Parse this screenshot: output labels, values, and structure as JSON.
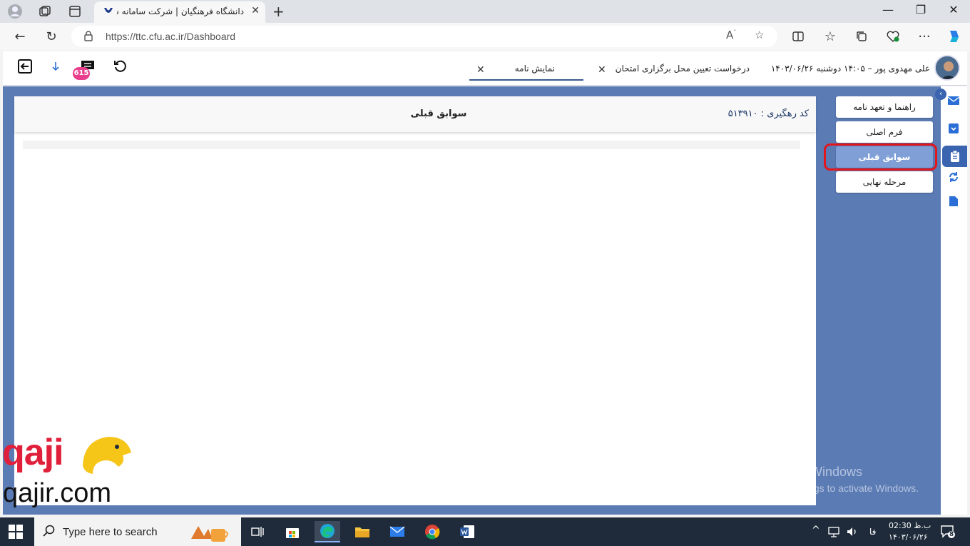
{
  "browser": {
    "tab_title": "دانشگاه فرهنگیان | شرکت سامانه س",
    "url": "https://ttc.cfu.ac.ir/Dashboard"
  },
  "app": {
    "user_line": "علی مهدوی پور – ۱۴:۰۵ دوشنبه ۱۴۰۳/۰۶/۲۶",
    "request_tab": "درخواست تعیین محل برگزاری امتحان",
    "active_tab": "نمایش نامه",
    "notification_count": "615"
  },
  "panel": {
    "title": "سوابق قبلی",
    "tracking": "کد رهگیری : ۵۱۳۹۱۰"
  },
  "steps": [
    {
      "label": "راهنما و تعهد نامه",
      "current": false
    },
    {
      "label": "فرم اصلی",
      "current": false
    },
    {
      "label": "سوابق قبلی",
      "current": true
    },
    {
      "label": "مرحله نهایی",
      "current": false
    }
  ],
  "watermark": {
    "activate_title": "Activate Windows",
    "activate_sub": "Go to Settings to activate Windows.",
    "brand_word": "qaji",
    "brand_domain": "qajir.com"
  },
  "taskbar": {
    "search_placeholder": "Type here to search",
    "lang": "فا",
    "time": "ب.ظ 02:30",
    "date": "۱۴۰۳/۰۶/۲۶",
    "notifications": "8"
  },
  "colors": {
    "workspace": "#5b7bb5",
    "active_step": "#7f9fd6",
    "highlight": "#e3161c",
    "badge": "#e83e8c"
  }
}
